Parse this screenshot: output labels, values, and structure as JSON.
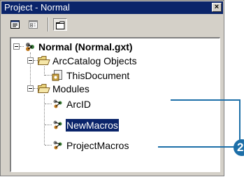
{
  "window": {
    "title": "Project - Normal",
    "close_glyph": "×"
  },
  "toolbar": {
    "buttons": [
      {
        "name": "view-code-icon"
      },
      {
        "name": "view-object-icon"
      },
      {
        "name": "toggle-folders-icon",
        "pressed": true
      }
    ]
  },
  "tree": {
    "root": {
      "label": "Normal (Normal.gxt)",
      "icon": "project-icon"
    },
    "folders": [
      {
        "label": "ArcCatalog Objects",
        "icon": "folder-open-icon",
        "children": [
          {
            "label": "ThisDocument",
            "icon": "document-object-icon"
          }
        ]
      },
      {
        "label": "Modules",
        "icon": "folder-open-icon",
        "children": [
          {
            "label": "ArcID",
            "icon": "module-icon"
          },
          {
            "label": "NewMacros",
            "icon": "module-icon",
            "selected": true
          },
          {
            "label": "ProjectMacros",
            "icon": "module-icon"
          }
        ]
      }
    ]
  },
  "callout": {
    "number": "2",
    "color": "#1d6fa8"
  },
  "colors": {
    "titlebar": "#0a246a",
    "selection": "#0a246a",
    "chrome": "#d4d0c8"
  }
}
